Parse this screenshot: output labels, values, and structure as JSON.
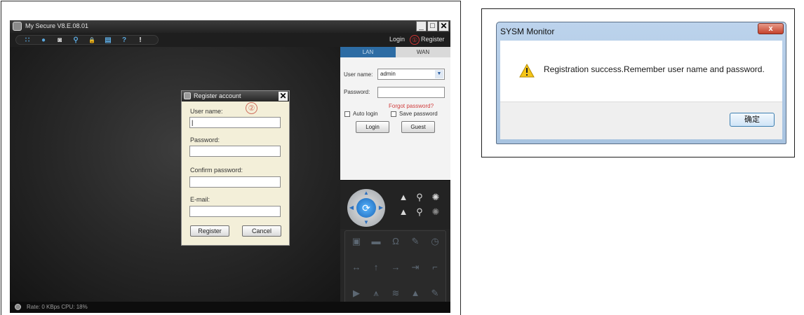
{
  "app": {
    "title": "My Secure  V8.E.08.01",
    "window_buttons": [
      "_",
      "□",
      "✕"
    ],
    "toolbar_icons": [
      "grid-icon",
      "record-icon",
      "camera-icon",
      "search-icon",
      "lock-icon",
      "storage-icon",
      "help-icon",
      "info-icon"
    ],
    "toolbar_glyphs": [
      "∷",
      "●",
      "◙",
      "⚲",
      "🔒",
      "▤",
      "?",
      "!"
    ],
    "login_link": "Login",
    "register_link": "Register",
    "step1_marker": "①",
    "step2_marker": "②",
    "status_text": "Rate: 0 KBps  CPU:  18%"
  },
  "register_dialog": {
    "title": "Register account",
    "close": "✕",
    "user_name_label": "User name:",
    "user_name_value": "|",
    "password_label": "Password:",
    "confirm_password_label": "Confirm password:",
    "email_label": "E-mail:",
    "register_button": "Register",
    "cancel_button": "Cancel"
  },
  "login_panel": {
    "tab_lan": "LAN",
    "tab_wan": "WAN",
    "user_name_label": "User name:",
    "user_name_value": "admin",
    "password_label": "Password:",
    "forgot_password": "Forgot password?",
    "auto_login": "Auto login",
    "save_password": "Save password",
    "login_button": "Login",
    "guest_button": "Guest"
  },
  "ptz": {
    "grid_icons": [
      "snapshot-icon",
      "record-icon",
      "headphone-icon",
      "tools-icon",
      "clock-icon",
      "swap-icon",
      "up-arrow-icon",
      "right-arrow-icon",
      "export-icon",
      "corner-icon",
      "play-icon",
      "antenna-icon",
      "wifi-icon",
      "warning-icon",
      "wrench-icon"
    ],
    "grid_glyphs": [
      "▣",
      "▬",
      "Ω",
      "✎",
      "◷",
      "↔",
      "↑",
      "→",
      "⇥",
      "⌐",
      "▶",
      "⩚",
      "≋",
      "▲",
      "✎"
    ]
  },
  "message_box": {
    "title": "SYSM Monitor",
    "close": "x",
    "message": "Registration success.Remember user name and password.",
    "ok_button": "确定",
    "accent_color": "#3c7fb1"
  }
}
